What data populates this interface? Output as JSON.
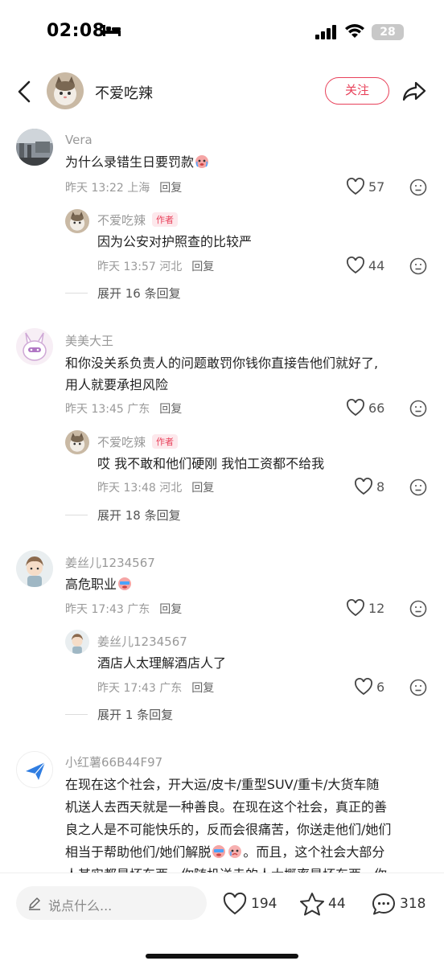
{
  "status_bar": {
    "time": "02:08",
    "battery": "28"
  },
  "header": {
    "author_name": "不爱吃辣",
    "follow_label": "关注"
  },
  "comments": [
    {
      "username": "Vera",
      "text": "为什么录错生日要罚款",
      "time": "昨天 13:22",
      "location": "上海",
      "reply_label": "回复",
      "likes": "57",
      "replies": [
        {
          "username": "不爱吃辣",
          "author_tag": "作者",
          "text": "因为公安对护照查的比较严",
          "time": "昨天 13:57",
          "location": "河北",
          "reply_label": "回复",
          "likes": "44"
        }
      ],
      "expand_label": "展开 16 条回复"
    },
    {
      "username": "美美大王",
      "text_line1": "和你没关系负责人的问题敢罚你钱你直接告他们就好了,",
      "text_line2": "用人就要承担风险",
      "time": "昨天 13:45",
      "location": "广东",
      "reply_label": "回复",
      "likes": "66",
      "replies": [
        {
          "username": "不爱吃辣",
          "author_tag": "作者",
          "text": "哎 我不敢和他们硬刚 我怕工资都不给我",
          "time": "昨天 13:48",
          "location": "河北",
          "reply_label": "回复",
          "likes": "8"
        }
      ],
      "expand_label": "展开 18 条回复"
    },
    {
      "username": "姜丝儿1234567",
      "text": "高危职业",
      "time": "昨天 17:43",
      "location": "广东",
      "reply_label": "回复",
      "likes": "12",
      "replies": [
        {
          "username": "姜丝儿1234567",
          "text": "酒店人太理解酒店人了",
          "time": "昨天 17:43",
          "location": "广东",
          "reply_label": "回复",
          "likes": "6"
        }
      ],
      "expand_label": "展开 1 条回复"
    },
    {
      "username": "小红薯66B44F97",
      "text_line1": "在现在这个社会，开大运/皮卡/重型SUV/重卡/大货车随",
      "text_line2": "机送人去西天就是一种善良。在现在这个社会，真正的善",
      "text_line3": "良之人是不可能快乐的，反而会很痛苦，你送走他们/她们",
      "text_line4": "相当于帮助他们/她们解脱",
      "text_line4b": "。而且，这个社会大部分",
      "text_line5": "人其实都是坏东西，你随机送走的人大概率是坏东西，你"
    }
  ],
  "bottom_bar": {
    "input_placeholder": "说点什么...",
    "likes": "194",
    "favorites": "44",
    "comments": "318"
  },
  "colors": {
    "accent": "#e8415a",
    "muted_text": "#999999"
  }
}
